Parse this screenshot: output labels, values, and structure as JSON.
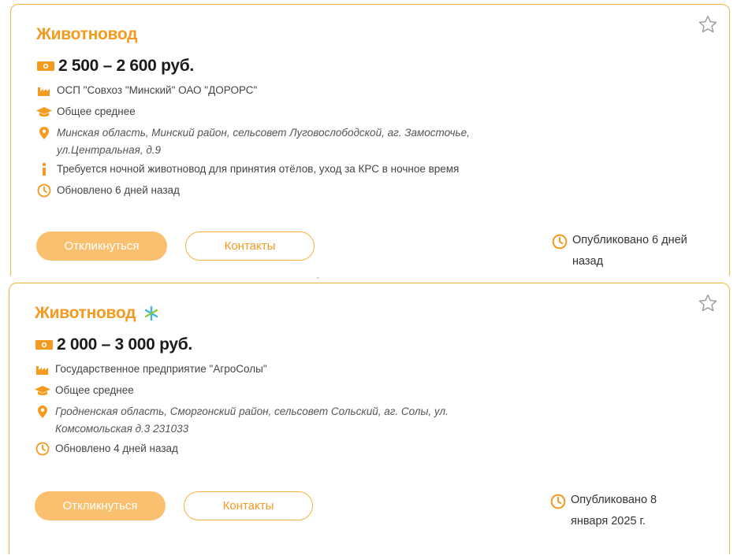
{
  "vacancies": [
    {
      "title": "Животновод",
      "has_badge": false,
      "salary": "2 500 – 2 600 руб.",
      "company": "ОСП \"Совхоз \"Минский\" ОАО \"ДОРОРС\"",
      "education": "Общее среднее",
      "address_line1": "Минская область, Минский район, сельсовет Луговослободской, аг. Замосточье,",
      "address_line2": "ул.Центральная, д.9",
      "info": "Требуется ночной животновод для принятия отёлов, уход за КРС в ночное время",
      "updated": "Обновлено 6 дней назад",
      "apply_label": "Откликнуться",
      "contacts_label": "Контакты",
      "published_line1": "Опубликовано 6 дней",
      "published_line2": "назад"
    },
    {
      "title": "Животновод",
      "has_badge": true,
      "salary": "2 000 – 3 000 руб.",
      "company": "Государственное предприятие \"АгроСолы\"",
      "education": "Общее среднее",
      "address_line1": "Гродненская область, Сморгонский район, сельсовет Сольский, аг. Солы, ул.",
      "address_line2": "Комсомольская д.3 231033",
      "updated": "Обновлено 4 дней назад",
      "apply_label": "Откликнуться",
      "contacts_label": "Контакты",
      "published_line1": "Опубликовано 8",
      "published_line2": "января 2025 г."
    }
  ],
  "colors": {
    "accent": "#f39a1f",
    "border": "#f5b23e",
    "button_fill": "#fbc06f",
    "badge_blue": "#3bb3e6",
    "badge_green": "#8cc63f"
  },
  "icons": [
    "star-icon",
    "money-icon",
    "factory-icon",
    "graduation-cap-icon",
    "location-pin-icon",
    "info-icon",
    "clock-icon",
    "sparkle-icon"
  ]
}
